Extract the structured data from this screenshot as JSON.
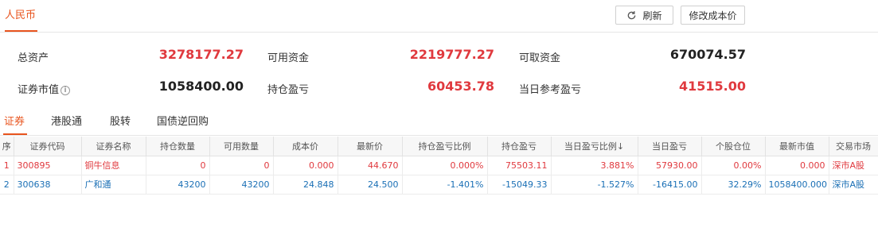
{
  "currency_tab": "人民币",
  "buttons": {
    "refresh": "刷新",
    "edit_cost": "修改成本价"
  },
  "summary": {
    "total_assets_label": "总资产",
    "total_assets": "3278177.27",
    "available_funds_label": "可用资金",
    "available_funds": "2219777.27",
    "withdrawable_funds_label": "可取资金",
    "withdrawable_funds": "670074.57",
    "market_value_label": "证券市值",
    "info_icon": "i",
    "market_value": "1058400.00",
    "position_pnl_label": "持仓盈亏",
    "position_pnl": "60453.78",
    "today_pnl_label": "当日参考盈亏",
    "today_pnl": "41515.00"
  },
  "sub_tabs": [
    "证券",
    "港股通",
    "股转",
    "国债逆回购"
  ],
  "table": {
    "headers": [
      "序",
      "证券代码",
      "证券名称",
      "持仓数量",
      "可用数量",
      "成本价",
      "最新价",
      "持仓盈亏比例",
      "持仓盈亏",
      "当日盈亏比例↓",
      "当日盈亏",
      "个股仓位",
      "最新市值",
      "交易市场"
    ],
    "rows": [
      [
        "1",
        "300895",
        "铜牛信息",
        "0",
        "0",
        "0.000",
        "44.670",
        "0.000%",
        "75503.11",
        "3.881%",
        "57930.00",
        "0.00%",
        "0.000",
        "深市A股"
      ],
      [
        "2",
        "300638",
        "广和通",
        "43200",
        "43200",
        "24.848",
        "24.500",
        "-1.401%",
        "-15049.33",
        "-1.527%",
        "-16415.00",
        "32.29%",
        "1058400.000",
        "深市A股"
      ]
    ]
  },
  "colors": {
    "accent": "#e8541e",
    "profit_red": "#e0393e",
    "loss_blue": "#1a6fb5"
  },
  "icons": {
    "refresh": "refresh-icon",
    "info": "info-icon"
  }
}
